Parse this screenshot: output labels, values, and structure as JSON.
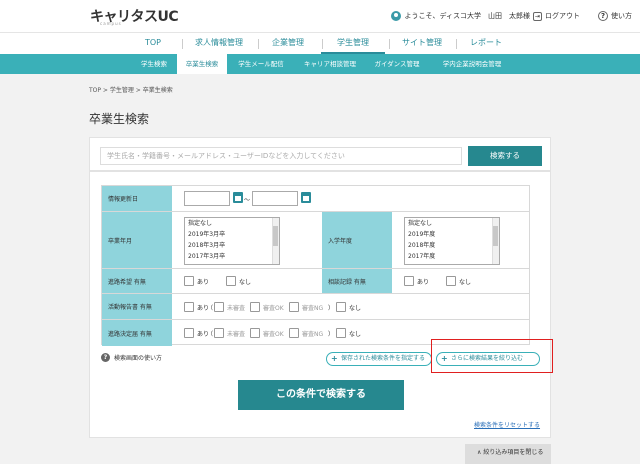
{
  "header": {
    "logo_main": "キャリタス",
    "logo_uc": "UC",
    "logo_sub": "campus",
    "welcome": "ようこそ、ディスコ大学　山田　太郎様",
    "logout": "ログアウト",
    "help": "使い方"
  },
  "mainnav": [
    "TOP",
    "求人情報管理",
    "企業管理",
    "学生管理",
    "サイト管理",
    "レポート"
  ],
  "subnav": [
    "学生検索",
    "卒業生検索",
    "学生メール配信",
    "キャリア相談管理",
    "ガイダンス管理",
    "学内企業説明会管理"
  ],
  "breadcrumb": "TOP > 学生管理 > 卒業生検索",
  "page_title": "卒業生検索",
  "search": {
    "placeholder": "学生氏名・学籍番号・メールアドレス・ユーザーIDなどを入力してください",
    "button": "検索する"
  },
  "form": {
    "updated_label": "情報更新日",
    "tilde": "〜",
    "grad_label": "卒業年月",
    "grad_options": [
      "指定なし",
      "2019年3月卒",
      "2018年3月卒",
      "2017年3月卒"
    ],
    "enroll_label": "入学年度",
    "enroll_options": [
      "指定なし",
      "2019年度",
      "2018年度",
      "2017年度"
    ],
    "path_hope_label": "進路希望 有無",
    "consult_label": "相談記録 有無",
    "activity_label": "活動報告書 有無",
    "decided_label": "進路決定届 有無",
    "ari": "あり",
    "nashi": "なし",
    "paren_open": "（",
    "paren_close": "）",
    "unreviewed": "未審査",
    "review_ok": "審査OK",
    "review_ng": "審査NG"
  },
  "help_link": "検索画面の使い方",
  "saved_conditions": "保存された検索条件を指定する",
  "narrow_more": "さらに検索結果を絞り込む",
  "search_big": "この条件で検索する",
  "reset_link": "検索条件をリセットする",
  "close_tab": "絞り込み項目を閉じる",
  "colors": {
    "teal": "#26888f",
    "light_teal": "#3ab0b8",
    "th_bg": "#8fd4dc",
    "highlight": "#e02020"
  }
}
